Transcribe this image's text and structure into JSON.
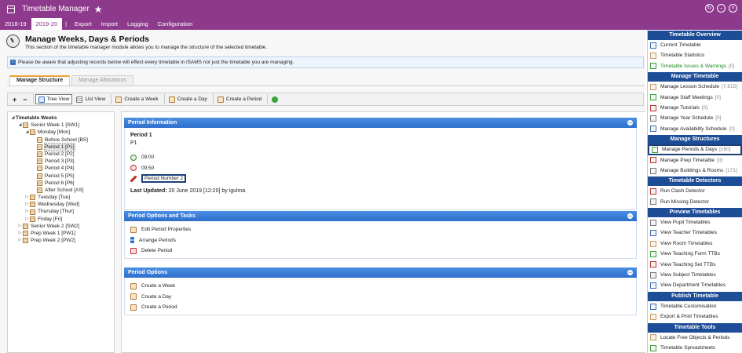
{
  "app": {
    "title": "Timetable Manager"
  },
  "menu": {
    "items": [
      "2018-19",
      "2019-20",
      "|",
      "Export",
      "Import",
      "Logging",
      "Configuration"
    ],
    "active": "2019-20"
  },
  "page": {
    "title": "Manage Weeks, Days & Periods",
    "subtitle": "This section of the timetable manager module allows you to manage the structure of the selected timetable."
  },
  "notice": "Please be aware that adjusting records below will effect every timetable in iSAMS not just the timetable you are managing.",
  "tabs": [
    {
      "label": "Manage Structure",
      "active": true
    },
    {
      "label": "Manage Allocations",
      "active": false
    }
  ],
  "toolbar": {
    "tree_view": "Tree View",
    "list_view": "List View",
    "create_week": "Create a Week",
    "create_day": "Create a Day",
    "create_period": "Create a Period"
  },
  "tree": {
    "root": "Timetable Weeks",
    "nodes": [
      {
        "label": "Senior Week 1 [SW1]",
        "depth": 1,
        "exp": "◢"
      },
      {
        "label": "Monday [Mon]",
        "depth": 2,
        "exp": "◢"
      },
      {
        "label": "Before School [BS]",
        "depth": 3,
        "exp": ""
      },
      {
        "label": "Period 1 [P1]",
        "depth": 3,
        "exp": "",
        "selected": true
      },
      {
        "label": "Period 2 [P2]",
        "depth": 3,
        "exp": ""
      },
      {
        "label": "Period 3 [P3]",
        "depth": 3,
        "exp": ""
      },
      {
        "label": "Period 4 [P4]",
        "depth": 3,
        "exp": ""
      },
      {
        "label": "Period 5 [P5]",
        "depth": 3,
        "exp": ""
      },
      {
        "label": "Period 6 [P6]",
        "depth": 3,
        "exp": ""
      },
      {
        "label": "After School [AS]",
        "depth": 3,
        "exp": ""
      },
      {
        "label": "Tuesday [Tue]",
        "depth": 2,
        "exp": "▷"
      },
      {
        "label": "Wednesday [Wed]",
        "depth": 2,
        "exp": "▷"
      },
      {
        "label": "Thursday [Thur]",
        "depth": 2,
        "exp": "▷"
      },
      {
        "label": "Friday [Fri]",
        "depth": 2,
        "exp": "▷"
      },
      {
        "label": "Senior Week 2 [SW2]",
        "depth": 1,
        "exp": "▷"
      },
      {
        "label": "Prep Week 1 [PW1]",
        "depth": 1,
        "exp": "▷"
      },
      {
        "label": "Prep Week 2 [PW2]",
        "depth": 1,
        "exp": "▷"
      }
    ]
  },
  "period_info": {
    "header": "Period Information",
    "name": "Period 1",
    "code": "P1",
    "start": "09:00",
    "end": "09:50",
    "number": "Period Number 2",
    "updated_label": "Last Updated:",
    "updated_value": "20 June 2019 [12:20] by igulma"
  },
  "period_options_tasks": {
    "header": "Period Options and Tasks",
    "items": [
      "Edit Period Properties",
      "Arrange Periods",
      "Delete Period"
    ]
  },
  "period_options": {
    "header": "Period Options",
    "items": [
      "Create a Week",
      "Create a Day",
      "Create a Period"
    ]
  },
  "sidebar": {
    "sections": [
      {
        "title": "Timetable Overview",
        "items": [
          {
            "label": "Current Timetable",
            "count": ""
          },
          {
            "label": "Timetable Statistics",
            "count": ""
          },
          {
            "label": "Timetable Issues & Warnings",
            "count": "[0]",
            "green": true
          }
        ]
      },
      {
        "title": "Manage Timetable",
        "items": [
          {
            "label": "Manage Lesson Schedule",
            "count": "[7,615]"
          },
          {
            "label": "Manage Staff Meetings",
            "count": "[0]"
          },
          {
            "label": "Manage Tutorials",
            "count": "[0]"
          },
          {
            "label": "Manage Year Schedule",
            "count": "[0]"
          },
          {
            "label": "Manage Availability Schedule",
            "count": "[0]"
          }
        ]
      },
      {
        "title": "Manage Structures",
        "items": [
          {
            "label": "Manage Periods & Days",
            "count": "[160]",
            "selected": true
          },
          {
            "label": "Manage Prep Timetable",
            "count": "[0]"
          },
          {
            "label": "Manage Buildings & Rooms",
            "count": "[171]"
          }
        ]
      },
      {
        "title": "Timetable Detectors",
        "items": [
          {
            "label": "Run Clash Detector",
            "count": ""
          },
          {
            "label": "Run Missing Detector",
            "count": ""
          }
        ]
      },
      {
        "title": "Preview Timetables",
        "items": [
          {
            "label": "View Pupil Timetables",
            "count": ""
          },
          {
            "label": "View Teacher Timetables",
            "count": ""
          },
          {
            "label": "View Room Timetables",
            "count": ""
          },
          {
            "label": "View Teaching Form TTBs",
            "count": ""
          },
          {
            "label": "View Teaching Set TTBs",
            "count": ""
          },
          {
            "label": "View Subject Timetables",
            "count": ""
          },
          {
            "label": "View Department Timetables",
            "count": ""
          }
        ]
      },
      {
        "title": "Publish Timetable",
        "items": [
          {
            "label": "Timetable Customisation",
            "count": ""
          },
          {
            "label": "Export & Print Timetables",
            "count": ""
          }
        ]
      },
      {
        "title": "Timetable Tools",
        "items": [
          {
            "label": "Locate Free Objects & Periods",
            "count": ""
          },
          {
            "label": "Timetable Spreadsheets",
            "count": ""
          }
        ]
      }
    ]
  },
  "colors": {
    "brand": "#8e3a8c",
    "panel_header": "#2d6fcc",
    "sidebar_header": "#1e4d97",
    "highlight": "#1d3f7a"
  }
}
